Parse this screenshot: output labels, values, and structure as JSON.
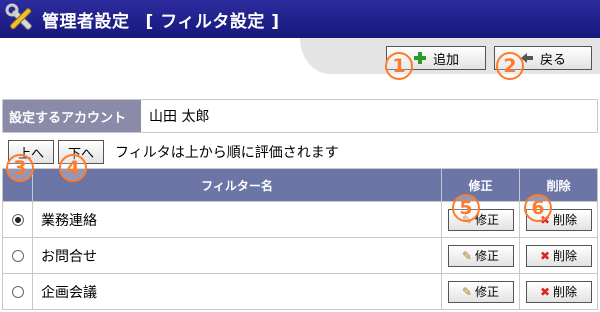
{
  "header": {
    "title": "管理者設定",
    "subtitle": "[ フィルタ設定 ]",
    "colors": {
      "bar": "#1a1a80",
      "text": "#ffffff"
    },
    "icon": "tools-icon"
  },
  "toolbar": {
    "add_label": "追加",
    "back_label": "戻る",
    "add_icon": "add-icon",
    "back_icon": "back-icon"
  },
  "account": {
    "label": "設定するアカウント",
    "value": "山田 太郎"
  },
  "order": {
    "up_label": "上へ",
    "down_label": "下へ",
    "note": "フィルタは上から順に評価されます"
  },
  "table": {
    "headers": {
      "name": "フィルター名",
      "edit": "修正",
      "delete": "削除"
    },
    "rows": [
      {
        "name": "業務連絡",
        "selected": true,
        "edit_label": "修正",
        "delete_label": "削除"
      },
      {
        "name": "お問合せ",
        "selected": false,
        "edit_label": "修正",
        "delete_label": "削除"
      },
      {
        "name": "企画会議",
        "selected": false,
        "edit_label": "修正",
        "delete_label": "削除"
      }
    ]
  },
  "callouts": [
    "1",
    "2",
    "3",
    "4",
    "5",
    "6"
  ],
  "callout_color": "#ff7a2a"
}
